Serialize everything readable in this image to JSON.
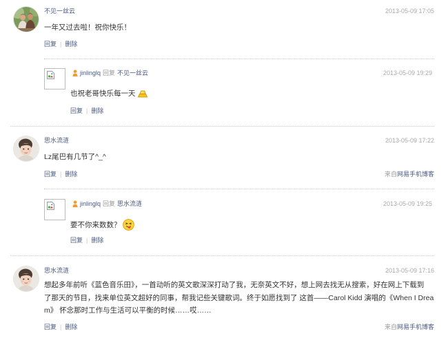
{
  "colors": {
    "link": "#4a5a84",
    "text": "#333333",
    "timestamp": "#aaaaaa",
    "muted": "#999999",
    "divider": "#c8c8c8",
    "user_icon": "#f39c2b"
  },
  "comments": [
    {
      "author": "不见一丝云",
      "time": "2013-05-09 17:05",
      "text": "一年又过去啦！祝你快乐！",
      "actions": {
        "reply": "回复",
        "divider": "|",
        "delete": "删除"
      },
      "reply": {
        "avatar_icon": "broken-image-icon",
        "name_icon": "user-icon",
        "author": "jinlinglq",
        "reply_word": "回复",
        "target": "不见一丝云",
        "time": "2013-05-09 19:29",
        "text": "也祝老哥快乐每一天",
        "emoticon": "gold-ingot-emoticon",
        "actions": {
          "reply": "回复",
          "divider": "|",
          "delete": "删除"
        }
      }
    },
    {
      "author": "思水流涟",
      "time": "2013-05-09 17:22",
      "text": "Lz尾巴有几节了^_^",
      "actions": {
        "reply": "回复",
        "divider": "|",
        "delete": "删除"
      },
      "source": {
        "prefix": "来自",
        "link": "网易手机博客"
      },
      "reply": {
        "avatar_icon": "broken-image-icon",
        "name_icon": "user-icon",
        "author": "jinlinglq",
        "reply_word": "回复",
        "target": "思水流涟",
        "time": "2013-05-09 19:25",
        "text": "要不你来数数？",
        "emoticon": "tongue-out-smiley-emoticon",
        "actions": {
          "reply": "回复",
          "divider": "|",
          "delete": "删除"
        }
      }
    },
    {
      "author": "思水流涟",
      "time": "2013-05-09 17:16",
      "text_lines": [
        "想起多年前听《蓝色音乐田》，一首动听的英文歌深深打动了我，无奈英文不好，想上网去找无从搜索，好在网上下载到",
        "了那天的节目，找来单位英文超好的同事，帮我记些关键歌词。终于如愿找到了 这首——Carol Kidd 演唱的《When I Drea",
        "m》 怀念那时工作与生活可以平衡的时候……哎……"
      ],
      "actions": {
        "reply": "回复",
        "divider": "|",
        "delete": "删除"
      },
      "source": {
        "prefix": "来自",
        "link": "网易手机博客"
      }
    }
  ]
}
